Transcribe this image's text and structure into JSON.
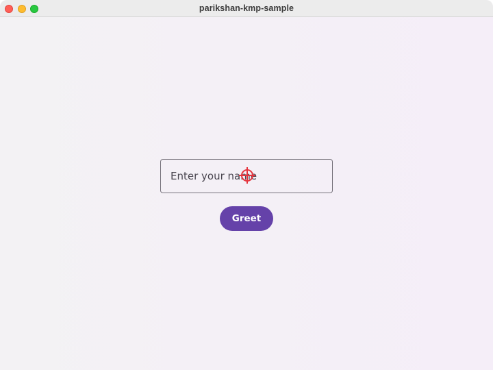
{
  "window": {
    "title": "parikshan-kmp-sample"
  },
  "form": {
    "name_placeholder": "Enter your name",
    "name_value": "",
    "greet_label": "Greet"
  },
  "theme": {
    "accent": "#6542a9",
    "cursor_color": "#e5343d"
  },
  "icons": {
    "cursor": "crosshair-target-icon"
  }
}
